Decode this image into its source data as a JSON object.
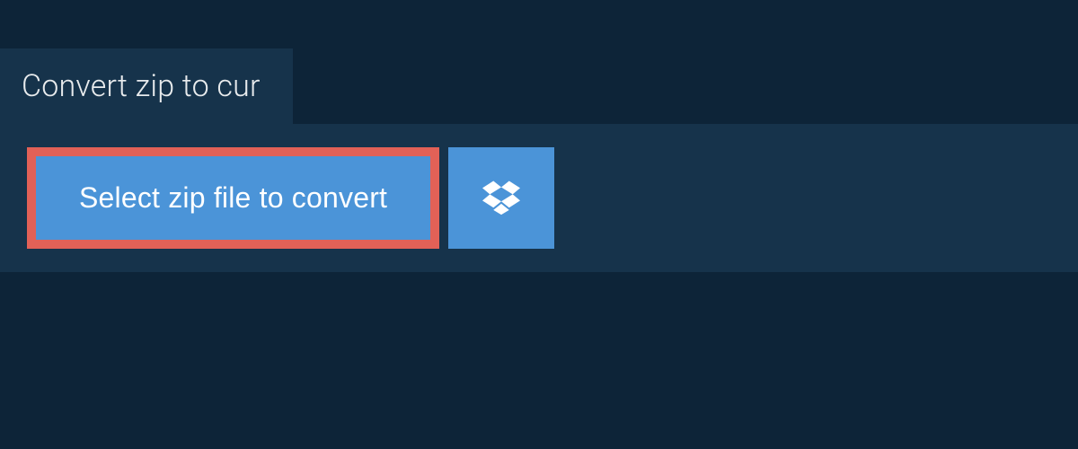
{
  "header": {
    "title": "Convert zip to cur"
  },
  "actions": {
    "select_file_label": "Select zip file to convert"
  },
  "colors": {
    "bg_outer": "#0d2438",
    "bg_panel": "#16334b",
    "button_blue": "#4b94d8",
    "highlight_border": "#e26157",
    "text_light": "#e8ebed",
    "text_white": "#ffffff"
  }
}
